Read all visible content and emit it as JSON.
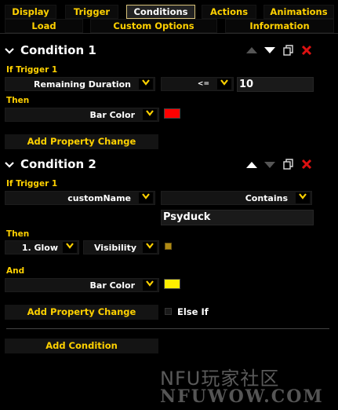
{
  "tabs": {
    "row1": [
      "Display",
      "Trigger",
      "Conditions",
      "Actions",
      "Animations"
    ],
    "row2": [
      "Load",
      "Custom Options",
      "Information"
    ],
    "active": "Conditions"
  },
  "condition1": {
    "title": "Condition 1",
    "if_label": "If Trigger 1",
    "property": "Remaining Duration",
    "operator": "<=",
    "value": "10",
    "then_label": "Then",
    "then_property": "Bar Color",
    "then_color": "#ff0000",
    "add_property_button": "Add Property Change"
  },
  "condition2": {
    "title": "Condition 2",
    "if_label": "If Trigger 1",
    "property": "customName",
    "operator": "Contains",
    "value": "Psyduck",
    "then_label": "Then",
    "then_target": "1. Glow",
    "then_property": "Visibility",
    "and_label": "And",
    "and_property": "Bar Color",
    "and_color": "#ffee00",
    "add_property_button": "Add Property Change",
    "else_if_label": "Else If"
  },
  "add_condition_button": "Add Condition",
  "watermark": {
    "line1": "NFU玩家社区",
    "line2": "NFUWOW.COM"
  },
  "icons": {
    "collapse": "chevron-down-icon",
    "move_up": "triangle-up-icon",
    "move_down": "triangle-down-icon",
    "duplicate": "duplicate-icon",
    "delete": "close-x-icon",
    "dropdown": "dropdown-arrow-icon"
  },
  "colors": {
    "accent": "#ffd100",
    "delete_red": "#dd1111"
  }
}
